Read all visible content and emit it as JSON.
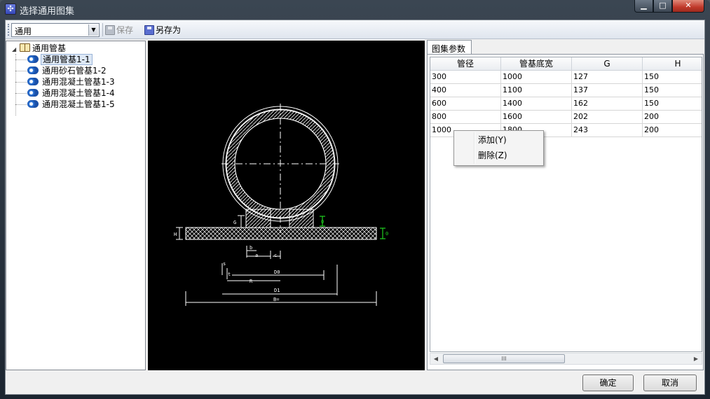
{
  "window": {
    "title": "选择通用图集",
    "minimize": "▁",
    "maximize": "□",
    "close": "✕"
  },
  "toolbar": {
    "combo_value": "通用",
    "save_label": "保存",
    "save_as_label": "另存为"
  },
  "tree": {
    "root": "通用管基",
    "items": [
      "通用管基1-1",
      "通用砂石管基1-2",
      "通用混凝土管基1-3",
      "通用混凝土管基1-4",
      "通用混凝土管基1-5"
    ],
    "selected_index": 0
  },
  "drawing": {
    "labels": {
      "G": "G",
      "H": "H",
      "I": "0",
      "I2": "0",
      "b": "b",
      "a": "a",
      "c": "c",
      "s": "s",
      "t": "t",
      "D0": "D0",
      "R": "R",
      "D1": "D1",
      "B": "B="
    }
  },
  "params_tab": {
    "label": "图集参数",
    "columns": [
      "管径",
      "管基底宽",
      "G",
      "H"
    ],
    "rows": [
      [
        "300",
        "1000",
        "127",
        "150"
      ],
      [
        "400",
        "1100",
        "137",
        "150"
      ],
      [
        "600",
        "1400",
        "162",
        "150"
      ],
      [
        "800",
        "1600",
        "202",
        "200"
      ],
      [
        "1000",
        "1800",
        "243",
        "200"
      ]
    ],
    "scroll_thumb": "III"
  },
  "context_menu": {
    "items": [
      "添加(Y)",
      "删除(Z)"
    ]
  },
  "footer": {
    "ok_label": "确定",
    "cancel_label": "取消"
  }
}
